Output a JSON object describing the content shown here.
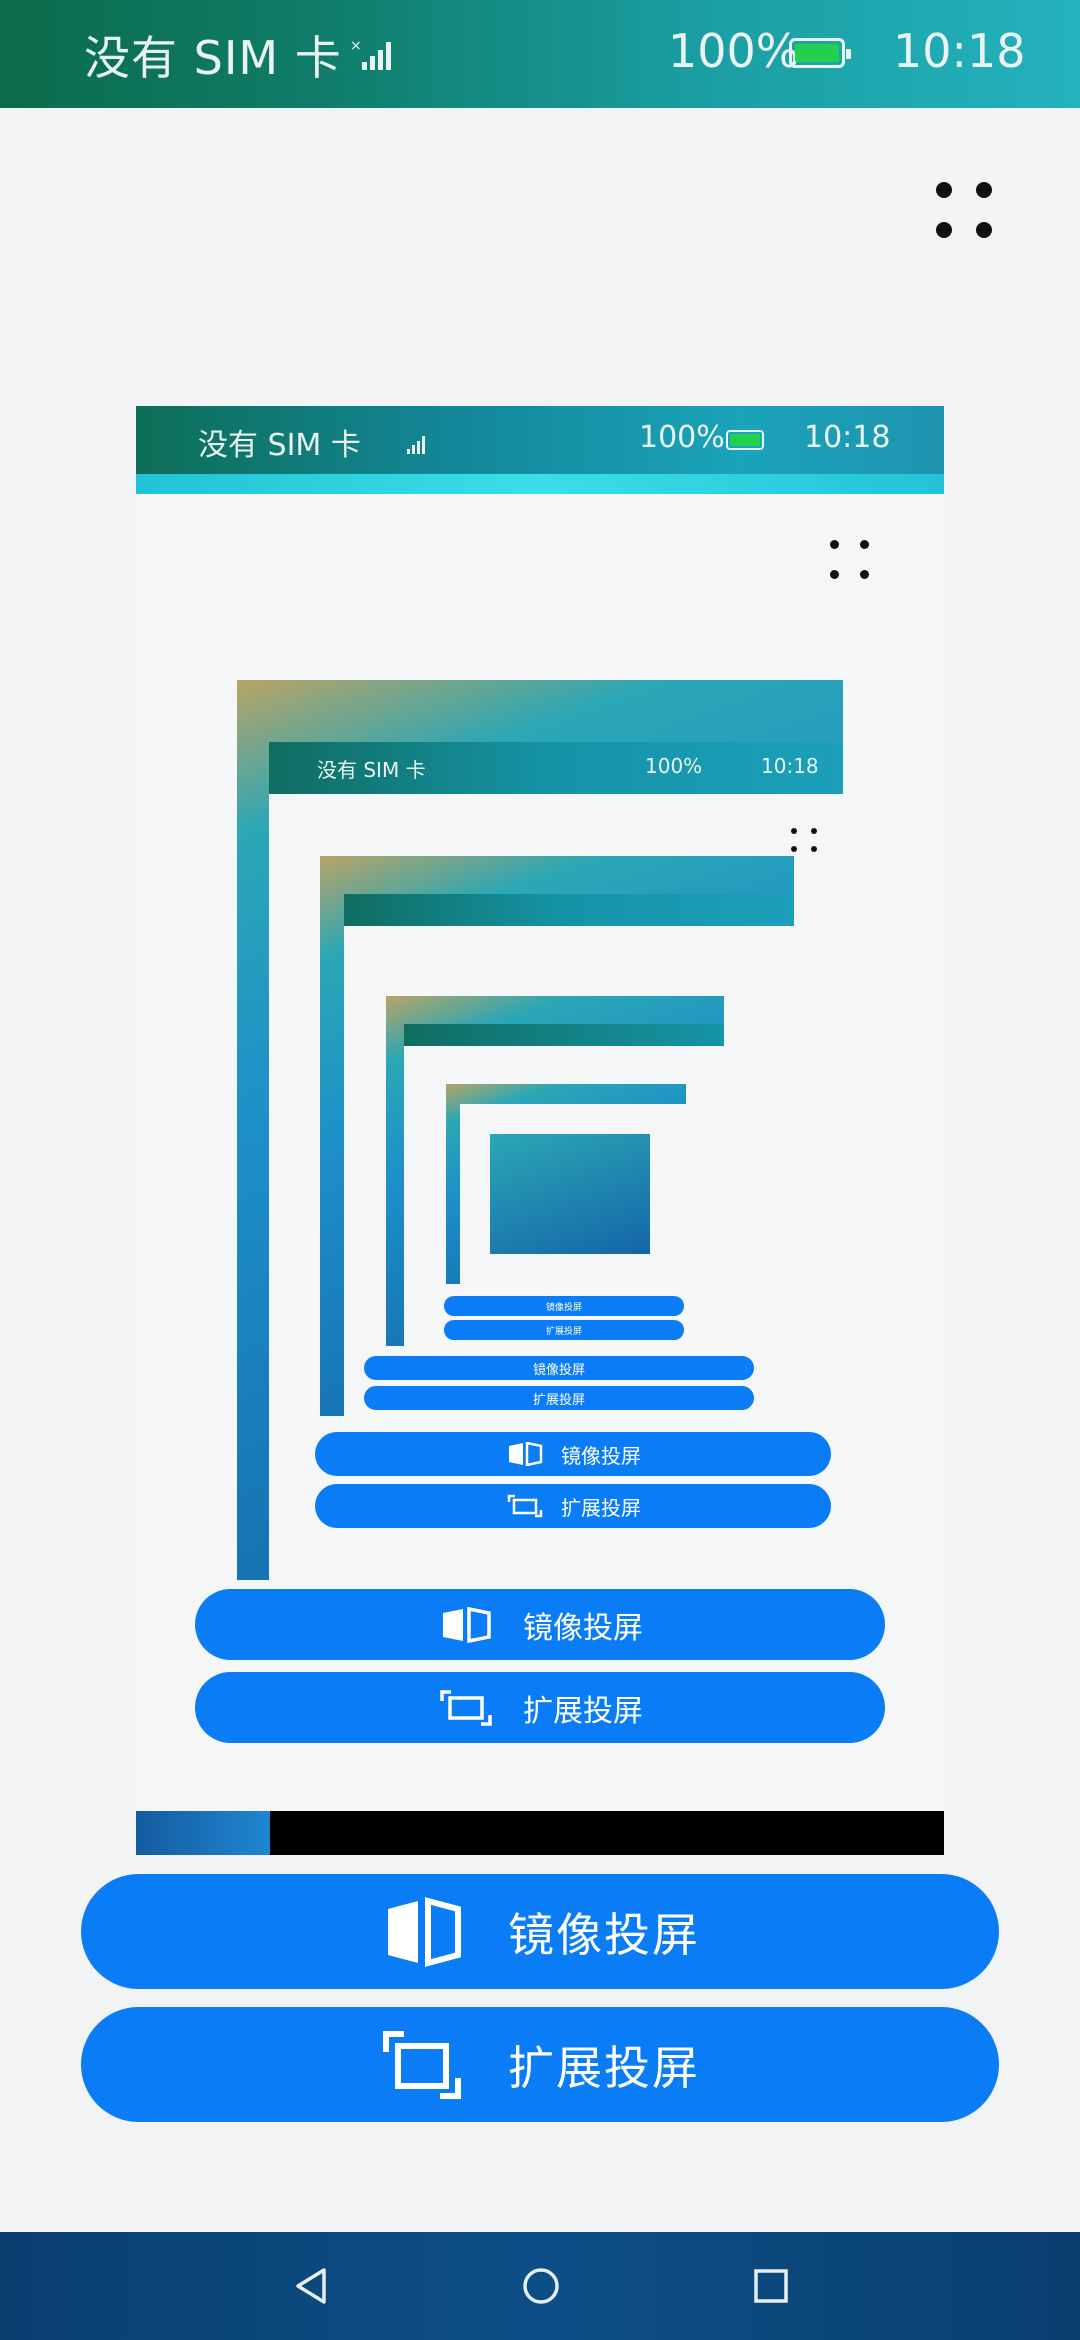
{
  "status_bar": {
    "carrier": "没有 SIM 卡",
    "battery_percent": "100%",
    "time": "10:18",
    "battery_color": "#23d04d"
  },
  "menu": {
    "icon": "more-dots-icon"
  },
  "preview": {
    "status_bar": {
      "carrier": "没有 SIM 卡",
      "battery_percent": "100%",
      "time": "10:18"
    },
    "buttons": {
      "mirror": "镜像投屏",
      "extend": "扩展投屏"
    },
    "nested": {
      "status_carrier": "没有 SIM 卡",
      "status_battery": "100%",
      "status_time": "10:18",
      "mirror": "镜像投屏",
      "extend": "扩展投屏"
    }
  },
  "actions": {
    "mirror_label": "镜像投屏",
    "mirror_icon": "mirror-screen-icon",
    "extend_label": "扩展投屏",
    "extend_icon": "extend-screen-icon",
    "accent_color": "#0a7cf6"
  },
  "nav": {
    "back_icon": "back-triangle-icon",
    "home_icon": "home-circle-icon",
    "recents_icon": "recents-square-icon"
  }
}
